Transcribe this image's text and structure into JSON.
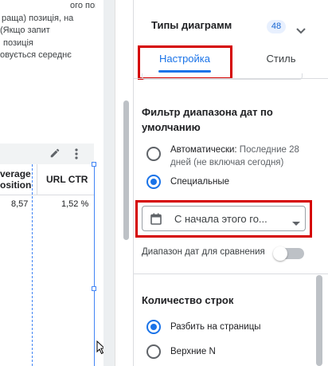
{
  "description_lines": [
    "ого пошукового",
    "раща) позиція, на",
    "(Якщо запит",
    "позиція",
    "овується середнє"
  ],
  "table": {
    "headers": [
      "verage osition",
      "URL CTR"
    ],
    "row": [
      "8,57",
      "1,52 %"
    ]
  },
  "panel": {
    "chart_types_label": "Типы диаграмм",
    "chart_types_count": "48",
    "tabs": [
      {
        "label": "Настройка",
        "active": true
      },
      {
        "label": "Стиль",
        "active": false
      }
    ],
    "date_filter": {
      "title": "Фильтр диапазона дат по умолчанию",
      "auto_label": "Автоматически:",
      "auto_hint": "Последние 28 дней (не включая сегодня)",
      "custom_label": "Специальные",
      "selected": "custom",
      "dropdown_value": "С начала этого го...",
      "compare_label": "Диапазон дат для сравнения",
      "compare_enabled": false
    },
    "rows": {
      "title": "Количество строк",
      "options": [
        {
          "label": "Разбить на страницы",
          "selected": true
        },
        {
          "label": "Верхние N",
          "selected": false
        }
      ]
    }
  },
  "colors": {
    "accent": "#1a73e8",
    "highlight": "#d50000",
    "selection": "#4285f4"
  }
}
